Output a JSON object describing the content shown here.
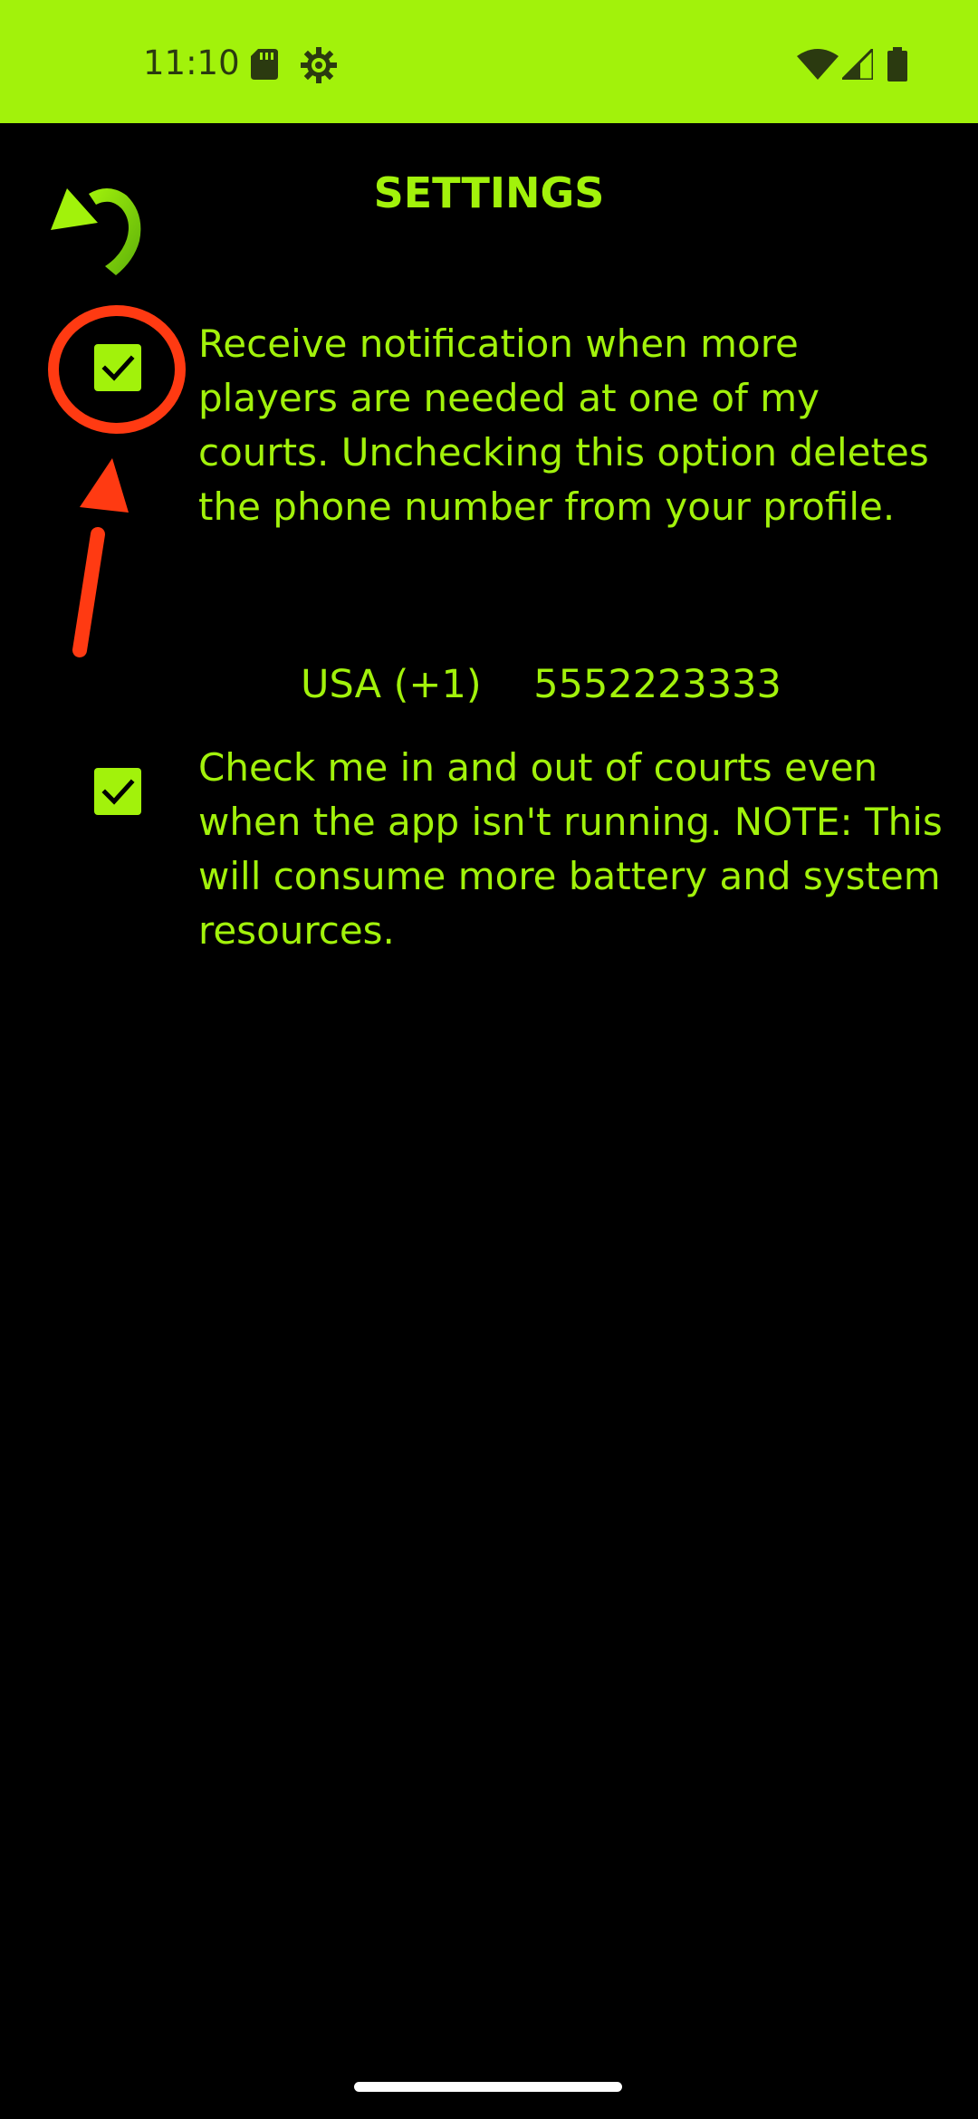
{
  "status_bar": {
    "time": "11:10",
    "icons": [
      "sd-card-icon",
      "settings-gear-icon",
      "wifi-icon",
      "signal-icon",
      "battery-icon"
    ]
  },
  "header": {
    "title": "SETTINGS",
    "back_icon": "back-arrow-icon"
  },
  "options": [
    {
      "checked": true,
      "text": "Receive notification when more players are needed at one of my courts. Unchecking this option deletes the phone number from your profile."
    },
    {
      "checked": true,
      "text": "Check me in and out of courts even when the app isn't running. NOTE: This will consume more battery and system resources."
    }
  ],
  "phone": {
    "country": "USA (+1)",
    "number": "5552223333"
  },
  "colors": {
    "accent": "#a2f20b",
    "background": "#000000",
    "annotation": "#ff3a12"
  }
}
